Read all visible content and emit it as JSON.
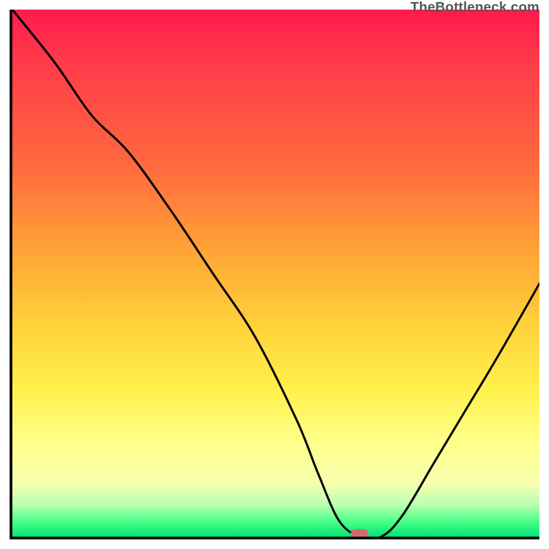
{
  "watermark": "TheBottleneck.com",
  "marker": {
    "x_pct": 65.5,
    "y_pct": 99.0
  },
  "colors": {
    "axis": "#000000",
    "curve": "#000000",
    "marker": "#d36b6b",
    "gradient_top": "#ff1a4d",
    "gradient_mid": "#ffd23a",
    "gradient_bottom": "#00e676"
  },
  "chart_data": {
    "type": "line",
    "title": "",
    "xlabel": "",
    "ylabel": "",
    "xlim": [
      0,
      100
    ],
    "ylim": [
      0,
      100
    ],
    "legend": null,
    "grid": false,
    "note": "Bottleneck curve. x = relative hardware balance (0–100). y = bottleneck percentage (0 good, 100 bad). Background gradient encodes y as red→yellow→green (high→low bottleneck). Pink marker = current configuration.",
    "series": [
      {
        "name": "bottleneck_curve",
        "x": [
          0,
          8,
          15,
          22,
          30,
          38,
          46,
          54,
          58,
          62,
          66,
          70,
          74,
          80,
          86,
          92,
          100
        ],
        "y": [
          100,
          90,
          80,
          73,
          62,
          50,
          38,
          22,
          12,
          3,
          0,
          0,
          4,
          14,
          24,
          34,
          48
        ]
      }
    ],
    "marker_point": {
      "x": 65.5,
      "y": 1.0
    }
  }
}
